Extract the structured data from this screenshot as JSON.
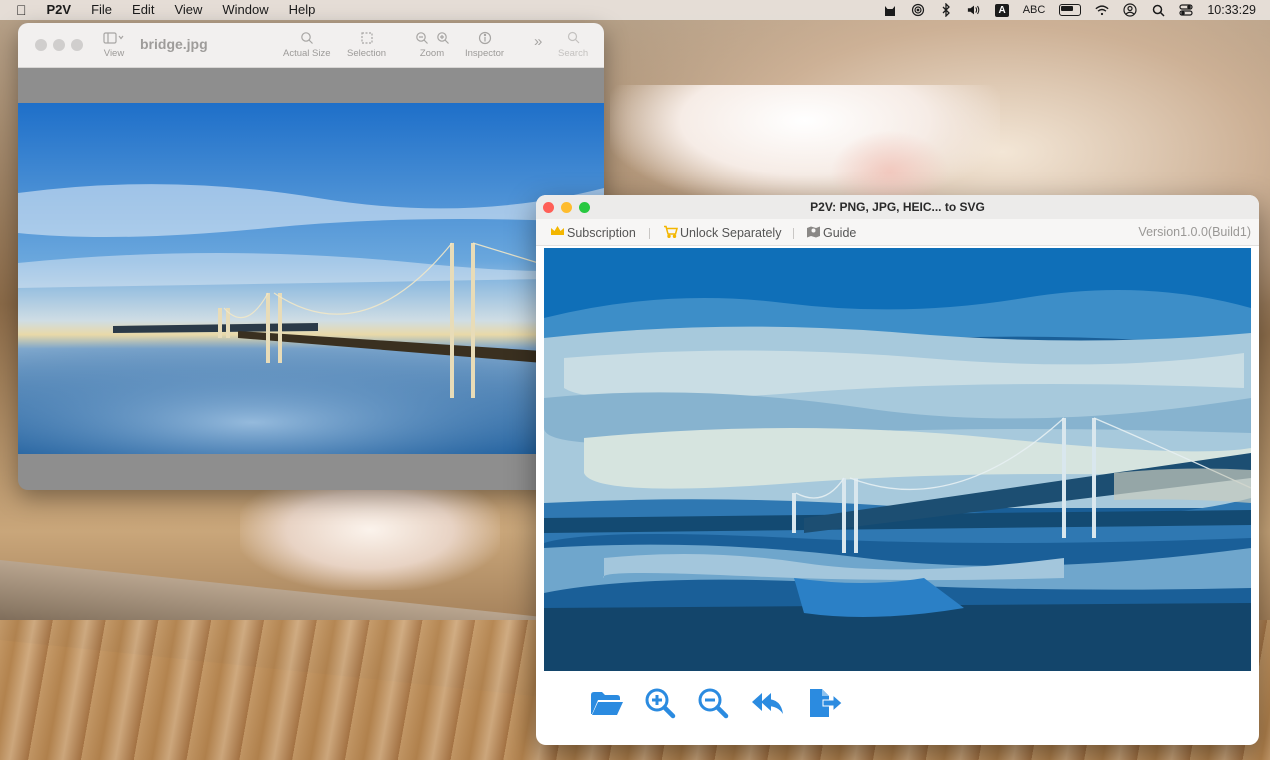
{
  "menubar": {
    "app_name": "P2V",
    "menus": [
      "File",
      "Edit",
      "View",
      "Window",
      "Help"
    ],
    "input_source": "ABC",
    "clock": "10:33:29"
  },
  "preview_window": {
    "title": "bridge.jpg",
    "toolbar": {
      "view_label": "View",
      "actual_size_label": "Actual Size",
      "selection_label": "Selection",
      "zoom_label": "Zoom",
      "inspector_label": "Inspector",
      "search_label": "Search"
    }
  },
  "p2v_window": {
    "title": "P2V: PNG, JPG, HEIC... to SVG",
    "menu": {
      "subscription": "Subscription",
      "unlock": "Unlock Separately",
      "guide": "Guide",
      "version": "Version1.0.0(Build1)"
    },
    "actions": [
      "open-folder",
      "zoom-in",
      "zoom-out",
      "undo",
      "export"
    ]
  },
  "colors": {
    "accent_blue": "#2b8be0",
    "close_red": "#ff5f57",
    "minimize_yellow": "#febc2e",
    "zoom_green": "#28c840",
    "crown_gold": "#f3b600"
  }
}
